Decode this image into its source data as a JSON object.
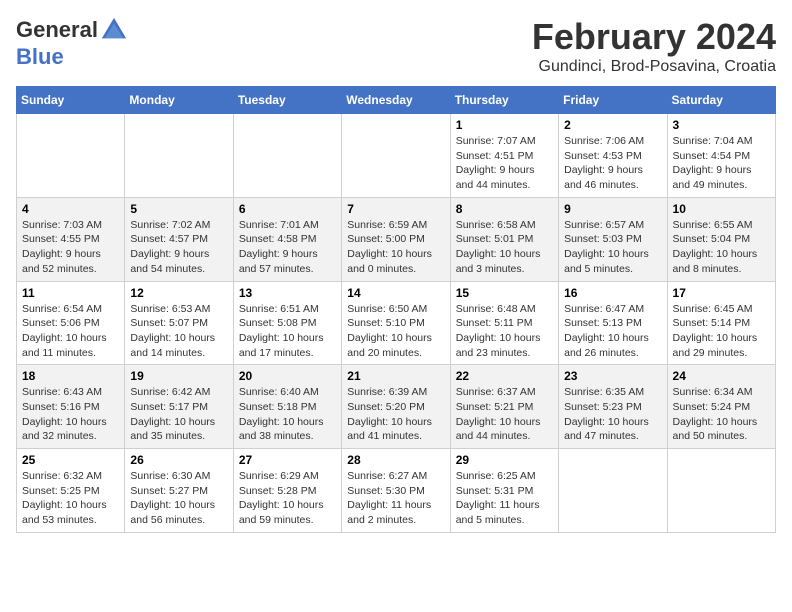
{
  "logo": {
    "general": "General",
    "blue": "Blue",
    "tagline": ""
  },
  "title": "February 2024",
  "subtitle": "Gundinci, Brod-Posavina, Croatia",
  "days": [
    "Sunday",
    "Monday",
    "Tuesday",
    "Wednesday",
    "Thursday",
    "Friday",
    "Saturday"
  ],
  "weeks": [
    [
      {
        "day": "",
        "content": ""
      },
      {
        "day": "",
        "content": ""
      },
      {
        "day": "",
        "content": ""
      },
      {
        "day": "",
        "content": ""
      },
      {
        "day": "1",
        "content": "Sunrise: 7:07 AM\nSunset: 4:51 PM\nDaylight: 9 hours and 44 minutes."
      },
      {
        "day": "2",
        "content": "Sunrise: 7:06 AM\nSunset: 4:53 PM\nDaylight: 9 hours and 46 minutes."
      },
      {
        "day": "3",
        "content": "Sunrise: 7:04 AM\nSunset: 4:54 PM\nDaylight: 9 hours and 49 minutes."
      }
    ],
    [
      {
        "day": "4",
        "content": "Sunrise: 7:03 AM\nSunset: 4:55 PM\nDaylight: 9 hours and 52 minutes."
      },
      {
        "day": "5",
        "content": "Sunrise: 7:02 AM\nSunset: 4:57 PM\nDaylight: 9 hours and 54 minutes."
      },
      {
        "day": "6",
        "content": "Sunrise: 7:01 AM\nSunset: 4:58 PM\nDaylight: 9 hours and 57 minutes."
      },
      {
        "day": "7",
        "content": "Sunrise: 6:59 AM\nSunset: 5:00 PM\nDaylight: 10 hours and 0 minutes."
      },
      {
        "day": "8",
        "content": "Sunrise: 6:58 AM\nSunset: 5:01 PM\nDaylight: 10 hours and 3 minutes."
      },
      {
        "day": "9",
        "content": "Sunrise: 6:57 AM\nSunset: 5:03 PM\nDaylight: 10 hours and 5 minutes."
      },
      {
        "day": "10",
        "content": "Sunrise: 6:55 AM\nSunset: 5:04 PM\nDaylight: 10 hours and 8 minutes."
      }
    ],
    [
      {
        "day": "11",
        "content": "Sunrise: 6:54 AM\nSunset: 5:06 PM\nDaylight: 10 hours and 11 minutes."
      },
      {
        "day": "12",
        "content": "Sunrise: 6:53 AM\nSunset: 5:07 PM\nDaylight: 10 hours and 14 minutes."
      },
      {
        "day": "13",
        "content": "Sunrise: 6:51 AM\nSunset: 5:08 PM\nDaylight: 10 hours and 17 minutes."
      },
      {
        "day": "14",
        "content": "Sunrise: 6:50 AM\nSunset: 5:10 PM\nDaylight: 10 hours and 20 minutes."
      },
      {
        "day": "15",
        "content": "Sunrise: 6:48 AM\nSunset: 5:11 PM\nDaylight: 10 hours and 23 minutes."
      },
      {
        "day": "16",
        "content": "Sunrise: 6:47 AM\nSunset: 5:13 PM\nDaylight: 10 hours and 26 minutes."
      },
      {
        "day": "17",
        "content": "Sunrise: 6:45 AM\nSunset: 5:14 PM\nDaylight: 10 hours and 29 minutes."
      }
    ],
    [
      {
        "day": "18",
        "content": "Sunrise: 6:43 AM\nSunset: 5:16 PM\nDaylight: 10 hours and 32 minutes."
      },
      {
        "day": "19",
        "content": "Sunrise: 6:42 AM\nSunset: 5:17 PM\nDaylight: 10 hours and 35 minutes."
      },
      {
        "day": "20",
        "content": "Sunrise: 6:40 AM\nSunset: 5:18 PM\nDaylight: 10 hours and 38 minutes."
      },
      {
        "day": "21",
        "content": "Sunrise: 6:39 AM\nSunset: 5:20 PM\nDaylight: 10 hours and 41 minutes."
      },
      {
        "day": "22",
        "content": "Sunrise: 6:37 AM\nSunset: 5:21 PM\nDaylight: 10 hours and 44 minutes."
      },
      {
        "day": "23",
        "content": "Sunrise: 6:35 AM\nSunset: 5:23 PM\nDaylight: 10 hours and 47 minutes."
      },
      {
        "day": "24",
        "content": "Sunrise: 6:34 AM\nSunset: 5:24 PM\nDaylight: 10 hours and 50 minutes."
      }
    ],
    [
      {
        "day": "25",
        "content": "Sunrise: 6:32 AM\nSunset: 5:25 PM\nDaylight: 10 hours and 53 minutes."
      },
      {
        "day": "26",
        "content": "Sunrise: 6:30 AM\nSunset: 5:27 PM\nDaylight: 10 hours and 56 minutes."
      },
      {
        "day": "27",
        "content": "Sunrise: 6:29 AM\nSunset: 5:28 PM\nDaylight: 10 hours and 59 minutes."
      },
      {
        "day": "28",
        "content": "Sunrise: 6:27 AM\nSunset: 5:30 PM\nDaylight: 11 hours and 2 minutes."
      },
      {
        "day": "29",
        "content": "Sunrise: 6:25 AM\nSunset: 5:31 PM\nDaylight: 11 hours and 5 minutes."
      },
      {
        "day": "",
        "content": ""
      },
      {
        "day": "",
        "content": ""
      }
    ]
  ]
}
